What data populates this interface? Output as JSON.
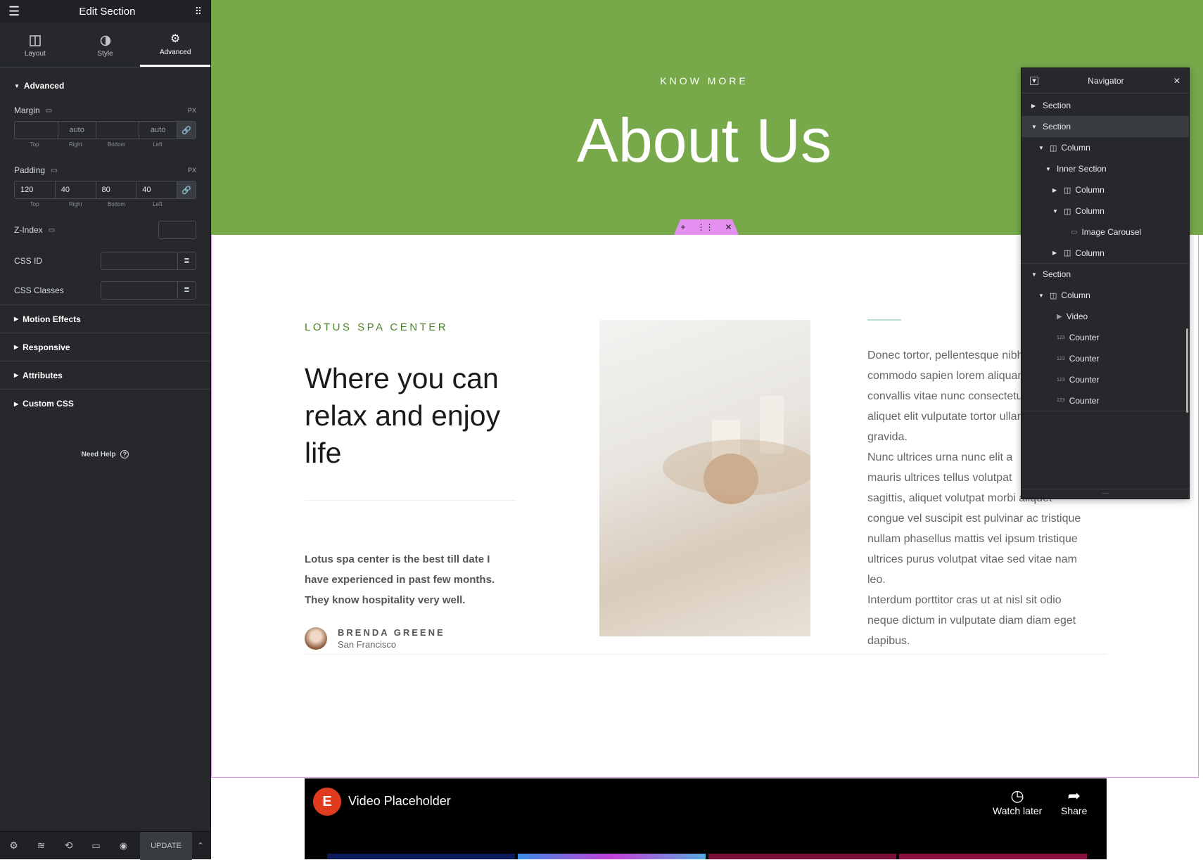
{
  "panel": {
    "title": "Edit Section",
    "tabs": [
      {
        "label": "Layout"
      },
      {
        "label": "Style"
      },
      {
        "label": "Advanced"
      }
    ],
    "advanced": {
      "title": "Advanced",
      "margin": {
        "label": "Margin",
        "unit": "PX",
        "values": [
          "",
          "auto",
          "",
          "auto"
        ],
        "sides": [
          "Top",
          "Right",
          "Bottom",
          "Left"
        ]
      },
      "padding": {
        "label": "Padding",
        "unit": "PX",
        "values": [
          "120",
          "40",
          "80",
          "40"
        ],
        "sides": [
          "Top",
          "Right",
          "Bottom",
          "Left"
        ]
      },
      "zindex": {
        "label": "Z-Index"
      },
      "cssid": {
        "label": "CSS ID"
      },
      "cssclasses": {
        "label": "CSS Classes"
      }
    },
    "sections": [
      "Motion Effects",
      "Responsive",
      "Attributes",
      "Custom CSS"
    ],
    "help": "Need Help",
    "update": "UPDATE"
  },
  "hero": {
    "eyebrow": "KNOW MORE",
    "title": "About Us"
  },
  "content": {
    "eyebrow": "LOTUS SPA CENTER",
    "heading_lines": [
      "Where you can",
      "relax and enjoy",
      "life"
    ],
    "quote_lines": [
      "Lotus spa center is the best till date I",
      "have experienced in past few months.",
      "They know hospitality very well."
    ],
    "author": "BRENDA GREENE",
    "location": "San Francisco",
    "body": [
      "Donec tortor, pellentesque nibh",
      "commodo sapien lorem aliquam,",
      "convallis vitae nunc consectetur",
      "aliquet elit vulputate tortor ullamcorper",
      "gravida.",
      "Nunc ultrices urna nunc elit a",
      "mauris ultrices tellus volutpat",
      "sagittis, aliquet volutpat morbi aliquet",
      "congue vel suscipit est pulvinar ac tristique",
      "nullam phasellus mattis vel ipsum tristique",
      "ultrices purus volutpat vitae sed vitae nam",
      "leo.",
      "Interdum porttitor cras ut at nisl sit odio",
      "neque dictum in vulputate diam diam eget",
      "dapibus."
    ]
  },
  "video": {
    "title": "Video Placeholder",
    "watch": "Watch later",
    "share": "Share"
  },
  "navigator": {
    "title": "Navigator",
    "items": [
      {
        "label": "Section"
      },
      {
        "label": "Section"
      },
      {
        "label": "Column"
      },
      {
        "label": "Inner Section"
      },
      {
        "label": "Column"
      },
      {
        "label": "Column"
      },
      {
        "label": "Image Carousel"
      },
      {
        "label": "Column"
      },
      {
        "label": "Section"
      },
      {
        "label": "Column"
      },
      {
        "label": "Video"
      },
      {
        "label": "Counter"
      },
      {
        "label": "Counter"
      },
      {
        "label": "Counter"
      },
      {
        "label": "Counter"
      }
    ]
  },
  "colors": {
    "hero_green": "#77a94b",
    "accent_pink": "#e58ff0",
    "brand_red": "#e03b1f"
  }
}
